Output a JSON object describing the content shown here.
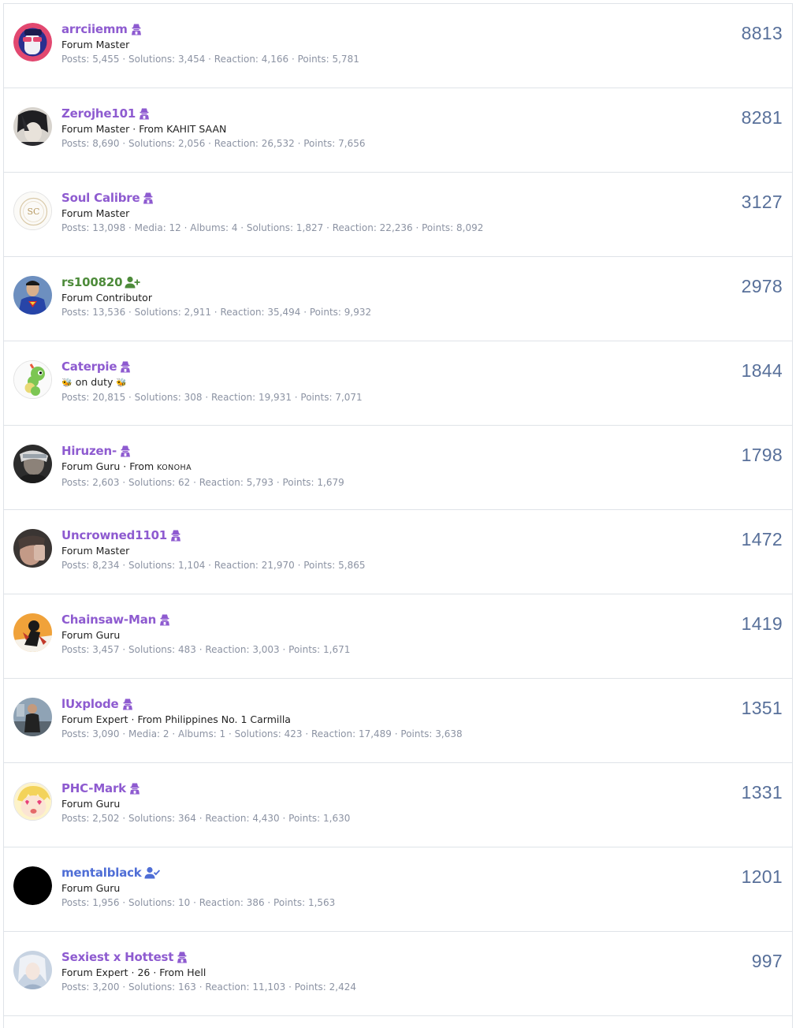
{
  "colors": {
    "username_default": "#8e5bd0",
    "username_contributor": "#4d8b3a",
    "username_verified": "#4f6ed6",
    "stats_text": "#8c93a3",
    "count_text": "#58709a",
    "row_border": "#dfe3e8"
  },
  "members": [
    {
      "username": "arrciiemm",
      "badge": "hacker-icon",
      "title": "Forum Master",
      "extra": "",
      "stats": "Posts: 5,455 · Solutions: 3,454 · Reaction: 4,166 · Points: 5,781",
      "count": "8813"
    },
    {
      "username": "Zerojhe101",
      "badge": "hacker-icon",
      "title": "Forum Master · From KAHIT SAAN",
      "extra": "",
      "stats": "Posts: 8,690 · Solutions: 2,056 · Reaction: 26,532 · Points: 7,656",
      "count": "8281"
    },
    {
      "username": "Soul Calibre",
      "badge": "hacker-icon",
      "title": "Forum Master",
      "extra": "",
      "stats": "Posts: 13,098 · Media: 12 · Albums: 4 · Solutions: 1,827 · Reaction: 22,236 · Points: 8,092",
      "count": "3127"
    },
    {
      "username": "rs100820",
      "badge": "user-plus-icon",
      "title": "Forum Contributor",
      "extra": "",
      "stats": "Posts: 13,536 · Solutions: 2,911 · Reaction: 35,494 · Points: 9,932",
      "count": "2978"
    },
    {
      "username": "Caterpie",
      "badge": "hacker-icon",
      "title": "on duty",
      "extra": "",
      "stats": "Posts: 20,815 · Solutions: 308 · Reaction: 19,931 · Points: 7,071",
      "count": "1844"
    },
    {
      "username": "Hiruzen-",
      "badge": "hacker-icon",
      "title": "Forum Guru · From",
      "extra": "KONOHA",
      "stats": "Posts: 2,603 · Solutions: 62 · Reaction: 5,793 · Points: 1,679",
      "count": "1798"
    },
    {
      "username": "Uncrowned1101",
      "badge": "hacker-icon",
      "title": "Forum Master",
      "extra": "",
      "stats": "Posts: 8,234 · Solutions: 1,104 · Reaction: 21,970 · Points: 5,865",
      "count": "1472"
    },
    {
      "username": "Chainsaw-Man",
      "badge": "hacker-icon",
      "title": "Forum Guru",
      "extra": "",
      "stats": "Posts: 3,457 · Solutions: 483 · Reaction: 3,003 · Points: 1,671",
      "count": "1419"
    },
    {
      "username": "lUxplode",
      "badge": "hacker-icon",
      "title": "Forum Expert · From Philippines No. 1 Carmilla",
      "extra": "",
      "stats": "Posts: 3,090 · Media: 2 · Albums: 1 · Solutions: 423 · Reaction: 17,489 · Points: 3,638",
      "count": "1351"
    },
    {
      "username": "PHC-Mark",
      "badge": "hacker-icon",
      "title": "Forum Guru",
      "extra": "",
      "stats": "Posts: 2,502 · Solutions: 364 · Reaction: 4,430 · Points: 1,630",
      "count": "1331"
    },
    {
      "username": "mentalblack",
      "badge": "user-check-icon",
      "title": "Forum Guru",
      "extra": "",
      "stats": "Posts: 1,956 · Solutions: 10 · Reaction: 386 · Points: 1,563",
      "count": "1201"
    },
    {
      "username": "Sexiest x Hottest",
      "badge": "hacker-icon",
      "title": "Forum Expert · 26 · From Hell",
      "extra": "",
      "stats": "Posts: 3,200 · Solutions: 163 · Reaction: 11,103 · Points: 2,424",
      "count": "997"
    }
  ]
}
